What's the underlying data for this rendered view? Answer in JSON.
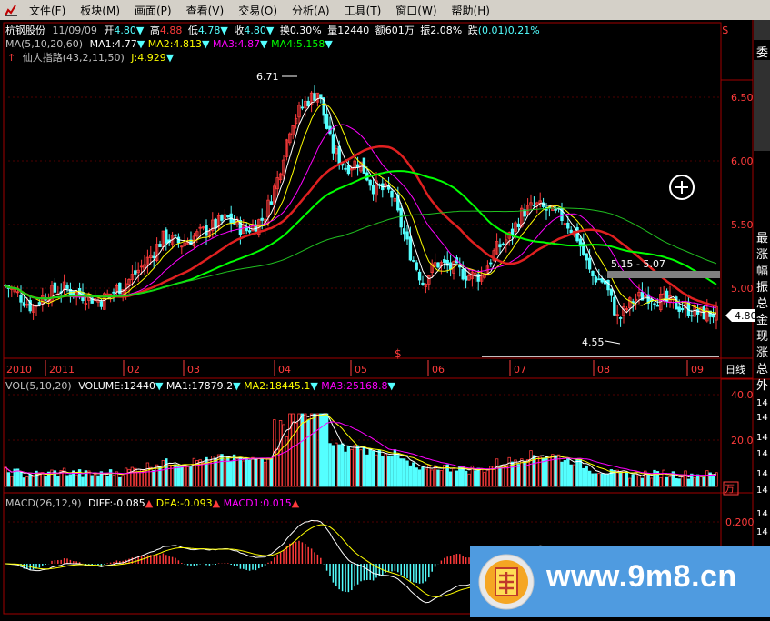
{
  "menu": {
    "items": [
      "文件(F)",
      "板块(M)",
      "画面(P)",
      "查看(V)",
      "交易(O)",
      "分析(A)",
      "工具(T)",
      "窗口(W)",
      "帮助(H)"
    ]
  },
  "quote": {
    "name": "杭钢股份",
    "date": "11/09/09",
    "open_label": "开",
    "open": "4.80",
    "open_arrow": "▼",
    "high_label": "高",
    "high": "4.88",
    "low_label": "低",
    "low": "4.78",
    "low_arrow": "▼",
    "close_label": "收",
    "close": "4.80",
    "close_arrow": "▼",
    "turnover_label": "换",
    "turnover": "0.30%",
    "volume_label": "量",
    "volume": "12440",
    "amount_label": "额",
    "amount": "601万",
    "amplitude_label": "振",
    "amplitude": "2.08%",
    "change_label": "跌",
    "change": "(0.01)",
    "change_pct": "0.21%",
    "dollar": "$"
  },
  "ma_line": {
    "name": "MA(5,10,20,60)",
    "ma1": "MA1:4.77",
    "ma2": "MA2:4.813",
    "ma3": "MA3:4.87",
    "ma4": "MA4:5.158"
  },
  "indicator_line": {
    "name": "仙人指路(43,2,11,50)",
    "j": "J:4.929"
  },
  "price_axis": {
    "ticks": [
      "6.50",
      "6.00",
      "5.50",
      "5.00"
    ],
    "current": "4.80"
  },
  "annotations": {
    "high": "6.71",
    "low": "4.55",
    "range": "5.15 - 5.07",
    "dollar_mark": "$"
  },
  "time_axis": {
    "labels": [
      "2010",
      "2011",
      "02",
      "03",
      "04",
      "05",
      "06",
      "07",
      "08",
      "09"
    ],
    "period": "日线"
  },
  "side_panel": {
    "top": "委",
    "chars": [
      "最",
      "涨",
      "幅",
      "振",
      "总",
      "金",
      "现",
      "涨",
      "总"
    ],
    "outer": "外",
    "values": [
      "14",
      "14",
      "14",
      "14",
      "14",
      "14",
      "14",
      "14"
    ]
  },
  "vol": {
    "name": "VOL(5,10,20)",
    "volume": "VOLUME:12440",
    "ma1": "MA1:17879.2",
    "ma2": "MA2:18445.1",
    "ma3": "MA3:25168.8",
    "ticks": [
      "40.0",
      "20.0"
    ],
    "unit": "万"
  },
  "macd": {
    "name": "MACD(26,12,9)",
    "diff": "DIFF:-0.085",
    "dea": "DEA:-0.093",
    "macd": "MACD1:0.015",
    "tick": "0.200"
  },
  "watermark": {
    "url": "www.9m8.cn"
  },
  "colors": {
    "up": "#ff3b3b",
    "down": "#54ffff",
    "ma1": "#ffffff",
    "ma2": "#ffff00",
    "ma3": "#ff00ff",
    "ma4": "#00ff00"
  }
}
